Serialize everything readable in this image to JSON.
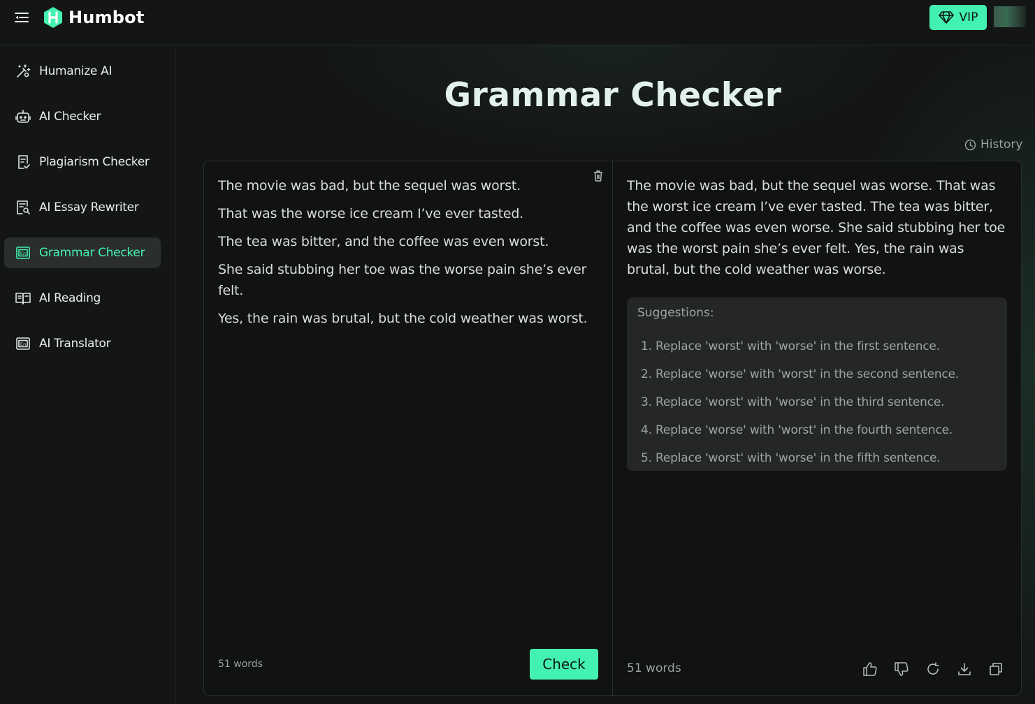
{
  "brand": {
    "name": "Humbot",
    "accent": "#43f2b0"
  },
  "topbar": {
    "vip_label": "VIP"
  },
  "sidebar": {
    "items": [
      {
        "label": "Humanize AI",
        "icon": "magic-wand-icon"
      },
      {
        "label": "AI Checker",
        "icon": "robot-icon"
      },
      {
        "label": "Plagiarism Checker",
        "icon": "document-check-icon"
      },
      {
        "label": "AI Essay Rewriter",
        "icon": "document-edit-icon"
      },
      {
        "label": "Grammar Checker",
        "icon": "grammar-en-icon",
        "active": true
      },
      {
        "label": "AI Reading",
        "icon": "book-icon"
      },
      {
        "label": "AI Translator",
        "icon": "translate-en-icon"
      }
    ]
  },
  "main": {
    "title": "Grammar Checker",
    "history_label": "History",
    "input": {
      "paragraphs": [
        "The movie was bad, but the sequel was worst.",
        "That was the worse ice cream I’ve ever tasted.",
        "The tea was bitter, and the coffee was even worst.",
        "She said stubbing her toe was the worse pain she’s ever felt.",
        "Yes, the rain was brutal, but the cold weather was worst."
      ],
      "word_count": "51 words",
      "check_label": "Check"
    },
    "output": {
      "text": "The movie was bad, but the sequel was worse. That was the worst ice cream I’ve ever tasted. The tea was bitter, and the coffee was even worse. She said stubbing her toe was the worst pain she’s ever felt. Yes, the rain was brutal, but the cold weather was worse.",
      "suggestions_title": "Suggestions:",
      "suggestions": [
        "1. Replace 'worst' with 'worse' in the first sentence.",
        "2. Replace 'worse' with 'worst' in the second sentence.",
        "3. Replace 'worst' with 'worse' in the third sentence.",
        "4. Replace 'worse' with 'worst' in the fourth sentence.",
        "5. Replace 'worst' with 'worse' in the fifth sentence."
      ],
      "word_count": "51 words",
      "actions": [
        "thumbs-up-icon",
        "thumbs-down-icon",
        "regenerate-icon",
        "download-icon",
        "copy-icon"
      ]
    }
  }
}
